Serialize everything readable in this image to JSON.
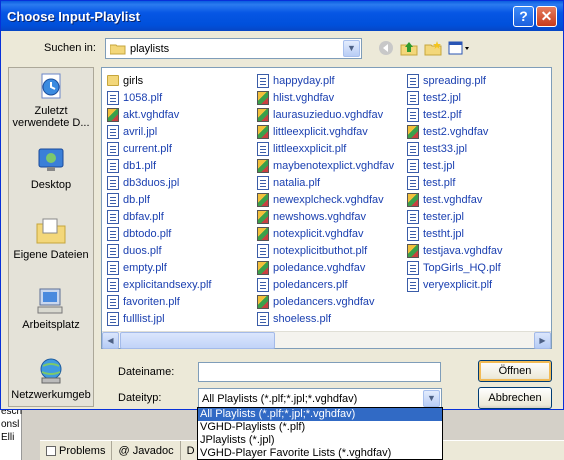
{
  "title": "Choose Input-Playlist",
  "lookin": {
    "label": "Suchen in:",
    "value": "playlists"
  },
  "places": [
    {
      "label": "Zuletzt verwendete D...",
      "icon": "recent-documents-icon"
    },
    {
      "label": "Desktop",
      "icon": "desktop-icon"
    },
    {
      "label": "Eigene Dateien",
      "icon": "my-documents-icon"
    },
    {
      "label": "Arbeitsplatz",
      "icon": "my-computer-icon"
    },
    {
      "label": "Netzwerkumgeb",
      "icon": "network-places-icon"
    }
  ],
  "files": {
    "col1": [
      {
        "name": "girls",
        "type": "folder"
      },
      {
        "name": "1058.plf",
        "type": "doc"
      },
      {
        "name": "akt.vghdfav",
        "type": "fav"
      },
      {
        "name": "avril.jpl",
        "type": "doc"
      },
      {
        "name": "current.plf",
        "type": "doc"
      },
      {
        "name": "db1.plf",
        "type": "doc"
      },
      {
        "name": "db3duos.jpl",
        "type": "doc"
      },
      {
        "name": "db.plf",
        "type": "doc"
      },
      {
        "name": "dbfav.plf",
        "type": "doc"
      },
      {
        "name": "dbtodo.plf",
        "type": "doc"
      },
      {
        "name": "duos.plf",
        "type": "doc"
      },
      {
        "name": "empty.plf",
        "type": "doc"
      },
      {
        "name": "explicitandsexy.plf",
        "type": "doc"
      },
      {
        "name": "favoriten.plf",
        "type": "doc"
      },
      {
        "name": "fulllist.jpl",
        "type": "doc"
      }
    ],
    "col2": [
      {
        "name": "happyday.plf",
        "type": "doc"
      },
      {
        "name": "hlist.vghdfav",
        "type": "fav"
      },
      {
        "name": "laurasuzieduo.vghdfav",
        "type": "fav"
      },
      {
        "name": "littleexplicit.vghdfav",
        "type": "fav"
      },
      {
        "name": "littleexxplicit.plf",
        "type": "doc"
      },
      {
        "name": "maybenotexplict.vghdfav",
        "type": "fav"
      },
      {
        "name": "natalia.plf",
        "type": "doc"
      },
      {
        "name": "newexplcheck.vghdfav",
        "type": "fav"
      },
      {
        "name": "newshows.vghdfav",
        "type": "fav"
      },
      {
        "name": "notexplicit.vghdfav",
        "type": "fav"
      },
      {
        "name": "notexplicitbuthot.plf",
        "type": "doc"
      },
      {
        "name": "poledance.vghdfav",
        "type": "fav"
      },
      {
        "name": "poledancers.plf",
        "type": "doc"
      },
      {
        "name": "poledancers.vghdfav",
        "type": "fav"
      },
      {
        "name": "shoeless.plf",
        "type": "doc"
      }
    ],
    "col3": [
      {
        "name": "spreading.plf",
        "type": "doc"
      },
      {
        "name": "test2.jpl",
        "type": "doc"
      },
      {
        "name": "test2.plf",
        "type": "doc"
      },
      {
        "name": "test2.vghdfav",
        "type": "fav"
      },
      {
        "name": "test33.jpl",
        "type": "doc"
      },
      {
        "name": "test.jpl",
        "type": "doc"
      },
      {
        "name": "test.plf",
        "type": "doc"
      },
      {
        "name": "test.vghdfav",
        "type": "fav"
      },
      {
        "name": "tester.jpl",
        "type": "doc"
      },
      {
        "name": "testht.jpl",
        "type": "doc"
      },
      {
        "name": "testjava.vghdfav",
        "type": "fav"
      },
      {
        "name": "TopGirls_HQ.plf",
        "type": "doc"
      },
      {
        "name": "veryexplicit.plf",
        "type": "doc"
      }
    ]
  },
  "filename": {
    "label": "Dateiname:",
    "value": ""
  },
  "filetype": {
    "label": "Dateityp:",
    "value": "All Playlists (*.plf;*.jpl;*.vghdfav)",
    "options": [
      "All Playlists (*.plf;*.jpl;*.vghdfav)",
      "VGHD-Playlists (*.plf)",
      "JPlaylists (*.jpl)",
      "VGHD-Player Favorite Lists (*.vghdfav)"
    ]
  },
  "buttons": {
    "open": "Öffnen",
    "cancel": "Abbrechen"
  },
  "background": {
    "left_fragments": [
      "escri",
      "onsl",
      "Elli"
    ],
    "tabs": [
      "Problems",
      "@ Javadoc",
      "D"
    ]
  },
  "colors": {
    "title_bar": "#0054e3",
    "selection": "#316ac5",
    "link_text": "#1a3fb0"
  }
}
